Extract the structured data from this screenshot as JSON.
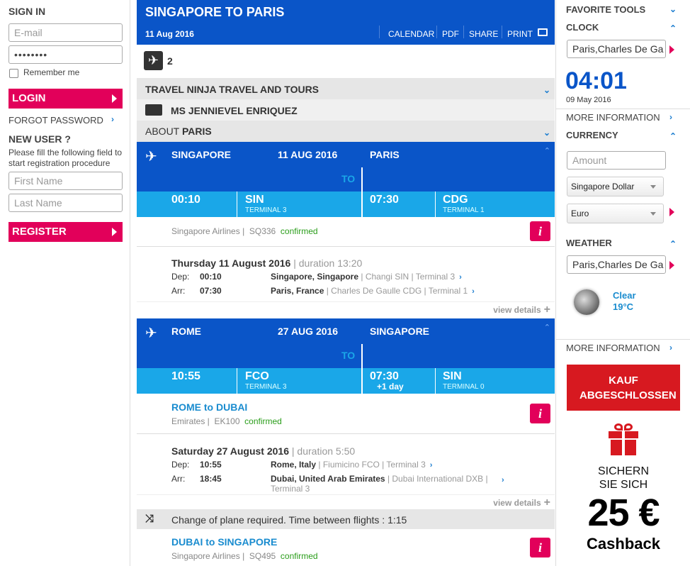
{
  "left": {
    "sign_in": "SIGN IN",
    "email_placeholder": "E-mail",
    "password_value": "••••••••",
    "remember_me": "Remember me",
    "login": "LOGIN",
    "forgot": "FORGOT PASSWORD",
    "new_user": "NEW USER ?",
    "new_user_text": "Please fill the following field to start registration procedure",
    "first_name": "First Name",
    "last_name": "Last Name",
    "register": "REGISTER"
  },
  "header": {
    "title": "SINGAPORE TO PARIS",
    "date": "11 Aug 2016",
    "actions": [
      "CALENDAR",
      "PDF",
      "SHARE",
      "PRINT"
    ]
  },
  "passengers": {
    "count": "2"
  },
  "agency": "TRAVEL NINJA TRAVEL AND TOURS",
  "traveler": "MS JENNIEVEL ENRIQUEZ",
  "about": {
    "prefix": "ABOUT",
    "city": "PARIS"
  },
  "legs": [
    {
      "from_city": "SINGAPORE",
      "date": "11 AUG 2016",
      "to_city": "PARIS",
      "to": "TO",
      "dep_time": "00:10",
      "dep_code": "SIN",
      "dep_terminal": "TERMINAL 3",
      "arr_time": "07:30",
      "arr_extra": "",
      "arr_code": "CDG",
      "arr_terminal": "TERMINAL 1",
      "segments": [
        {
          "route": "",
          "airline": "Singapore Airlines",
          "flight": "SQ336",
          "status": "confirmed",
          "day": "Thursday 11 August 2016",
          "duration": "duration 13:20",
          "dep_label": "Dep:",
          "dep_time": "00:10",
          "dep_place": "Singapore, Singapore",
          "dep_airport": "Changi SIN",
          "dep_terminal": "Terminal 3",
          "arr_label": "Arr:",
          "arr_time": "07:30",
          "arr_place": "Paris, France",
          "arr_airport": "Charles De Gaulle CDG",
          "arr_terminal": "Terminal 1",
          "view_details": "view details"
        }
      ]
    },
    {
      "from_city": "ROME",
      "date": "27 AUG 2016",
      "to_city": "SINGAPORE",
      "to": "TO",
      "dep_time": "10:55",
      "dep_code": "FCO",
      "dep_terminal": "TERMINAL 3",
      "arr_time": "07:30",
      "arr_extra": "+1 day",
      "arr_code": "SIN",
      "arr_terminal": "TERMINAL 0",
      "segments": [
        {
          "route": "ROME to DUBAI",
          "airline": "Emirates",
          "flight": "EK100",
          "status": "confirmed",
          "day": "Saturday 27 August 2016",
          "duration": "duration 5:50",
          "dep_label": "Dep:",
          "dep_time": "10:55",
          "dep_place": "Rome, Italy",
          "dep_airport": "Fiumicino FCO",
          "dep_terminal": "Terminal 3",
          "arr_label": "Arr:",
          "arr_time": "18:45",
          "arr_place": "Dubai, United Arab Emirates",
          "arr_airport": "Dubai International DXB",
          "arr_terminal": "Terminal 3",
          "view_details": "view details"
        },
        {
          "route": "DUBAI to SINGAPORE",
          "airline": "Singapore Airlines",
          "flight": "SQ495",
          "status": "confirmed"
        }
      ],
      "change_notice": "Change of plane required. Time between flights : 1:15"
    }
  ],
  "right": {
    "favorite_tools": "FAVORITE TOOLS",
    "clock": "CLOCK",
    "clock_city": "Paris,Charles De Ga",
    "time": "04:01",
    "clock_date": "09 May 2016",
    "more_info": "MORE INFORMATION",
    "currency": "CURRENCY",
    "amount_placeholder": "Amount",
    "currency_from": "Singapore Dollar",
    "currency_to": "Euro",
    "weather": "WEATHER",
    "weather_city": "Paris,Charles De Ga",
    "weather_desc": "Clear",
    "weather_temp": "19°C",
    "more_info2": "MORE INFORMATION",
    "ad_button": "KAUF ABGESCHLOSSEN",
    "ad_line1": "SICHERN",
    "ad_line2": "SIE SICH",
    "ad_amount": "25 €",
    "ad_cashback": "Cashback"
  },
  "colors": {
    "primary_blue": "#0a55c8",
    "light_blue": "#1aa7e8",
    "pink": "#e2005a",
    "red_ad": "#d71920",
    "confirmed": "#2a9d1a"
  }
}
